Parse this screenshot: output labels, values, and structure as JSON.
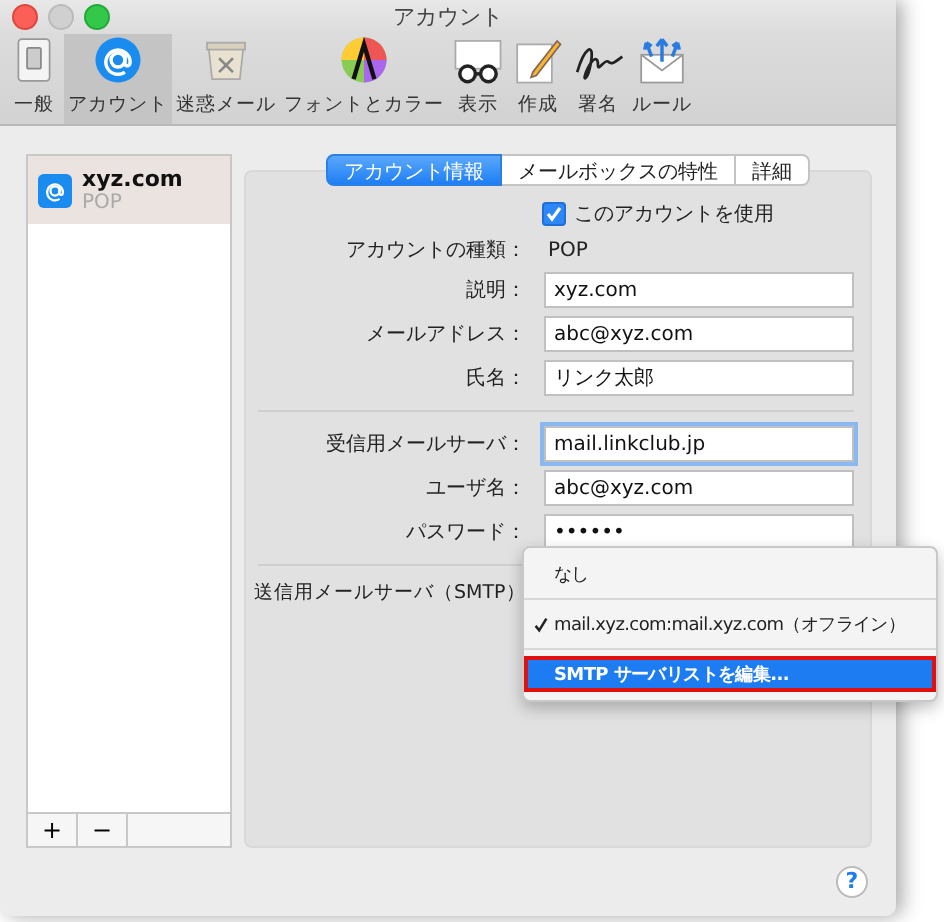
{
  "window": {
    "title": "アカウント"
  },
  "toolbar": [
    {
      "label": "一般",
      "kind": "switch",
      "selected": false
    },
    {
      "label": "アカウント",
      "kind": "at",
      "selected": true
    },
    {
      "label": "迷惑メール",
      "kind": "trash",
      "selected": false
    },
    {
      "label": "フォントとカラー",
      "kind": "palette",
      "selected": false
    },
    {
      "label": "表示",
      "kind": "glasses",
      "selected": false
    },
    {
      "label": "作成",
      "kind": "pencil",
      "selected": false
    },
    {
      "label": "署名",
      "kind": "signature",
      "selected": false
    },
    {
      "label": "ルール",
      "kind": "rules",
      "selected": false
    }
  ],
  "sidebar": {
    "accounts": [
      {
        "name": "xyz.com",
        "type": "POP",
        "selected": true
      }
    ],
    "buttons": [
      "+",
      "−"
    ]
  },
  "tabs": [
    {
      "label": "アカウント情報",
      "selected": true
    },
    {
      "label": "メールボックスの特性",
      "selected": false
    },
    {
      "label": "詳細",
      "selected": false
    }
  ],
  "enable_checkbox": {
    "label": "このアカウントを使用",
    "checked": true
  },
  "sections": [
    [
      {
        "kind": "static",
        "label": "アカウントの種類：",
        "value": "POP"
      },
      {
        "kind": "field",
        "label": "説明：",
        "value": "xyz.com",
        "focused": false
      },
      {
        "kind": "field",
        "label": "メールアドレス：",
        "value": "abc@xyz.com",
        "focused": false
      },
      {
        "kind": "field",
        "label": "氏名：",
        "value": "リンク太郎",
        "focused": false
      }
    ],
    [
      {
        "kind": "field",
        "label": "受信用メールサーバ：",
        "value": "mail.linkclub.jp",
        "focused": true
      },
      {
        "kind": "field",
        "label": "ユーザ名：",
        "value": "abc@xyz.com",
        "focused": false
      },
      {
        "kind": "field",
        "label": "パスワード：",
        "value": "••••••",
        "focused": false
      }
    ],
    [
      {
        "kind": "popup",
        "label": "送信用メールサーバ（SMTP）"
      }
    ]
  ],
  "smtp_menu": [
    {
      "kind": "item",
      "label": "なし",
      "checked": false,
      "selected": false
    },
    {
      "kind": "separator"
    },
    {
      "kind": "item",
      "label": "mail.xyz.com:mail.xyz.com（オフライン）",
      "checked": true,
      "selected": false
    },
    {
      "kind": "separator"
    },
    {
      "kind": "item",
      "label": "SMTP サーバリストを編集...",
      "checked": false,
      "selected": true
    }
  ],
  "help_button": "?"
}
